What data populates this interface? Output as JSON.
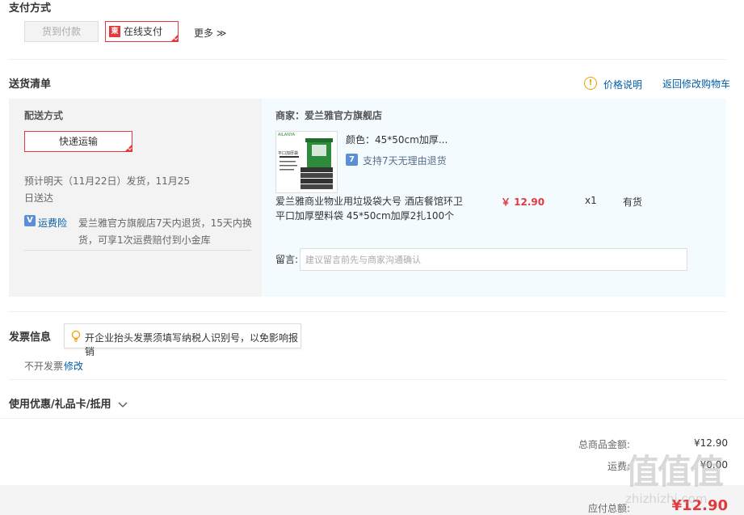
{
  "payment": {
    "title": "支付方式",
    "cod_label": "货到付款",
    "jd_badge": "東",
    "online_label": "在线支付",
    "more_label": "更多 ≫"
  },
  "delivery": {
    "title": "送货清单",
    "price_note": "价格说明",
    "back_cart": "返回修改购物车",
    "method_label": "配送方式",
    "method_option": "快递运输",
    "eta_line1": "预计明天（11月22日）发货，11月25",
    "eta_line2": "日送达",
    "insurance_link": "运费险",
    "insurance_line1": "爱兰雅官方旗舰店7天内退货，15天内换",
    "insurance_line2": "货，可享1次运费赔付到小金库",
    "seller_label": "商家：爱兰雅官方旗舰店",
    "color_label": "颜色：45*50cm加厚...",
    "return_badge": "7",
    "return_policy": "支持7天无理由退货",
    "product_name_line1": "爱兰雅商业物业用垃圾袋大号 酒店餐馆环卫",
    "product_name_line2": "平口加厚塑料袋 45*50cm加厚2扎100个",
    "price": "￥ 12.90",
    "quantity": "x1",
    "stock": "有货",
    "message_label": "留言:",
    "message_placeholder": "建议留言前先与商家沟通确认",
    "img_brand": "AILANYA",
    "img_caption": "平口加厚袋"
  },
  "invoice": {
    "title": "发票信息",
    "tip": "开企业抬头发票须填写纳税人识别号，以免影响报销",
    "status": "不开发票",
    "edit": "修改"
  },
  "coupon": {
    "title": "使用优惠/礼品卡/抵用"
  },
  "summary": {
    "goods_label": "总商品金额:",
    "goods_value": "¥12.90",
    "shipping_label": "运费:",
    "shipping_value": "¥0.00",
    "payable_label": "应付总额:",
    "payable_value": "¥12.90"
  },
  "watermark": {
    "text": "值值值",
    "sub": "zhizhizhi.com"
  }
}
